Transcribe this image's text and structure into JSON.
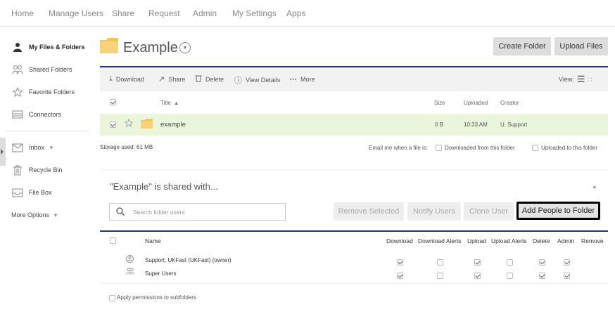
{
  "topnav": {
    "items": [
      "Home",
      "Manage Users",
      "Share",
      "Request",
      "Admin",
      "My Settings",
      "Apps"
    ]
  },
  "sidebar": {
    "items": [
      {
        "label": "My Files & Folders",
        "icon": "user-icon"
      },
      {
        "label": "Shared Folders",
        "icon": "users-icon"
      },
      {
        "label": "Favorite Folders",
        "icon": "star-icon"
      },
      {
        "label": "Connectors",
        "icon": "connector-icon"
      },
      {
        "label": "Inbox",
        "icon": "envelope-icon"
      },
      {
        "label": "Recycle Bin",
        "icon": "trash-icon"
      },
      {
        "label": "File Box",
        "icon": "inbox-tray-icon"
      }
    ],
    "more_options": "More Options"
  },
  "header": {
    "title": "Example",
    "create_folder": "Create Folder",
    "upload_files": "Upload Files"
  },
  "toolbar": {
    "download": "Download",
    "share": "Share",
    "delete": "Delete",
    "view_details": "View Details",
    "more": "More",
    "view_label": "View:"
  },
  "file_table": {
    "columns": {
      "title": "Title",
      "size": "Size",
      "uploaded": "Uploaded",
      "creator": "Creator"
    },
    "rows": [
      {
        "title": "example",
        "size": "0 B",
        "uploaded": "10:33 AM",
        "creator": "U. Support",
        "checked": true
      }
    ]
  },
  "storage": {
    "used": "Storage used: 61 MB",
    "email_label": "Email me when a file is:",
    "downloaded_option": "Downloaded from this folder",
    "uploaded_option": "Uploaded to this folder"
  },
  "share_panel": {
    "title": "\"Example\" is shared with...",
    "search_placeholder": "Search folder users",
    "remove_selected": "Remove Selected",
    "notify_users": "Notify Users",
    "clone_user": "Clone User",
    "add_people": "Add People to Folder",
    "columns": [
      "Name",
      "Download",
      "Download Alerts",
      "Upload",
      "Upload Alerts",
      "Delete",
      "Admin",
      "Remove"
    ],
    "users": [
      {
        "name": "Support, UKFast (UKFast) (owner)",
        "icon": "user-circle-icon",
        "perms": [
          true,
          false,
          true,
          false,
          true,
          true
        ]
      },
      {
        "name": "Super Users",
        "icon": "group-icon",
        "perms": [
          true,
          false,
          true,
          false,
          true,
          true
        ]
      }
    ],
    "apply_subfolders": "Apply permissions to subfolders"
  },
  "colors": {
    "accent_bar": "#1c3a6e",
    "selected_row": "#eaf5dc",
    "folder": "#f2c45a"
  }
}
